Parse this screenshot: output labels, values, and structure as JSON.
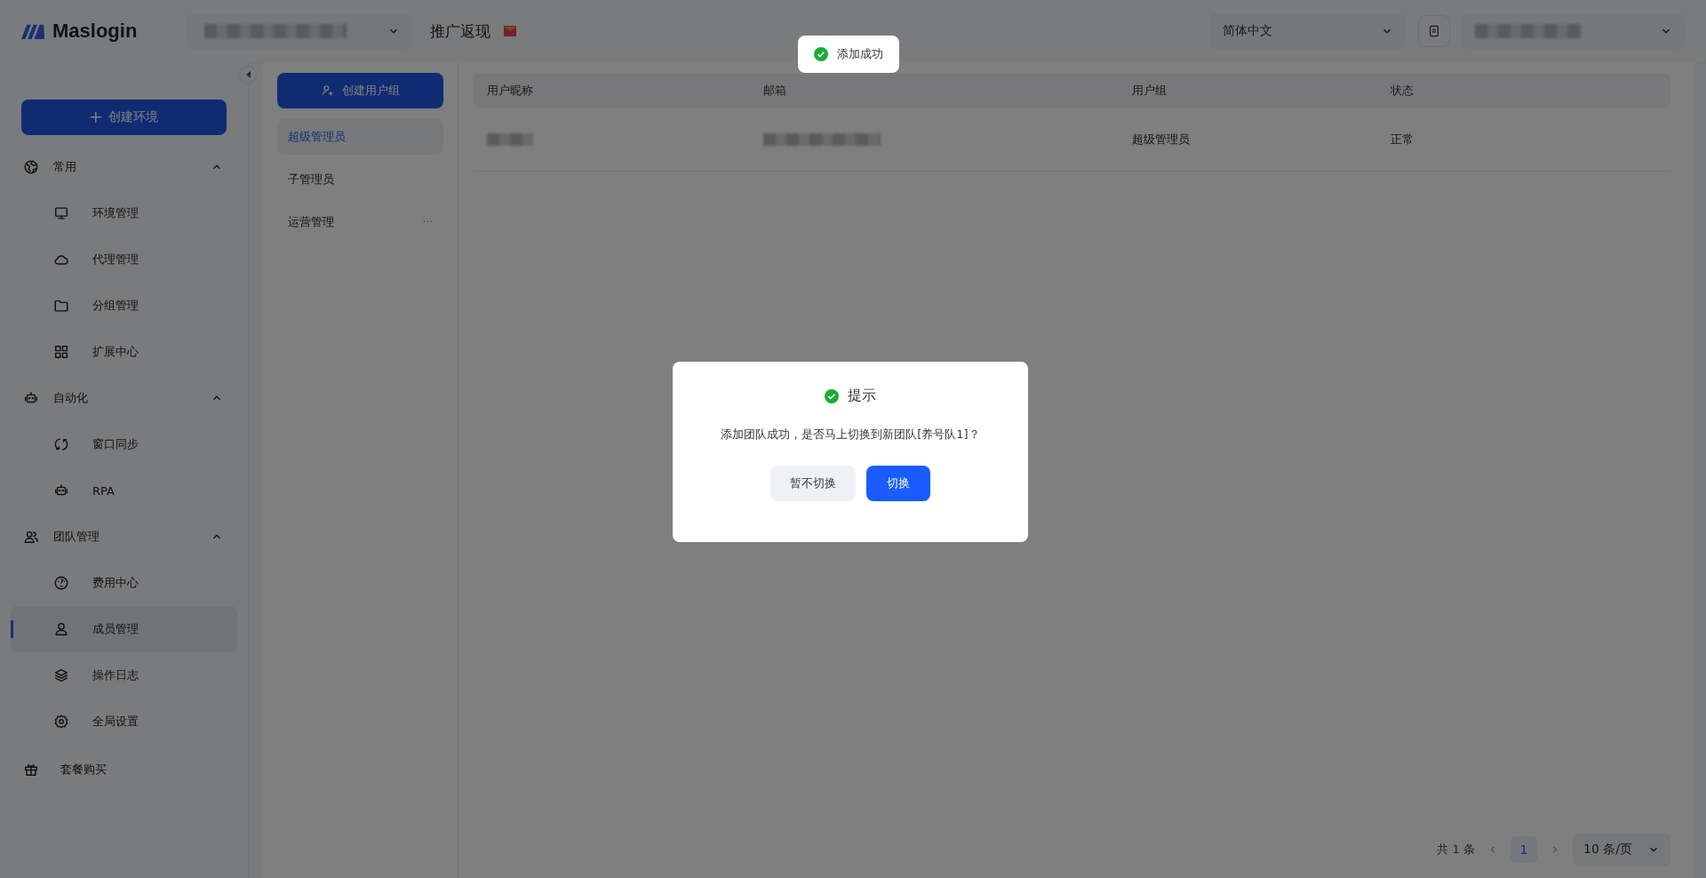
{
  "topbar": {
    "logo": "Maslogin",
    "promo": "推广返现",
    "language": "简体中文"
  },
  "toast": {
    "message": "添加成功"
  },
  "sidebar": {
    "create_button": "创建环境",
    "sections": [
      {
        "label": "常用",
        "expanded": true,
        "items": [
          {
            "label": "环境管理",
            "selected": false
          },
          {
            "label": "代理管理",
            "selected": false
          },
          {
            "label": "分组管理",
            "selected": false
          },
          {
            "label": "扩展中心",
            "selected": false
          }
        ]
      },
      {
        "label": "自动化",
        "expanded": true,
        "items": [
          {
            "label": "窗口同步",
            "selected": false
          },
          {
            "label": "RPA",
            "selected": false
          }
        ]
      },
      {
        "label": "团队管理",
        "expanded": true,
        "items": [
          {
            "label": "费用中心",
            "selected": false
          },
          {
            "label": "成员管理",
            "selected": true
          },
          {
            "label": "操作日志",
            "selected": false
          },
          {
            "label": "全局设置",
            "selected": false
          }
        ]
      }
    ],
    "footer_item": "套餐购买"
  },
  "groups": {
    "create_button": "创建用户组",
    "items": [
      {
        "label": "超级管理员",
        "selected": true
      },
      {
        "label": "子管理员",
        "selected": false
      },
      {
        "label": "运营管理",
        "selected": false,
        "menu": "···"
      }
    ]
  },
  "table": {
    "columns": [
      "用户昵称",
      "邮箱",
      "用户组",
      "状态"
    ],
    "rows": [
      {
        "group": "超级管理员",
        "status": "正常"
      }
    ]
  },
  "pagination": {
    "total": "共 1 条",
    "pages": [
      {
        "label": "1",
        "selected": true
      }
    ],
    "page_size": "10 条/页"
  },
  "dialog": {
    "title": "提示",
    "message": "添加团队成功，是否马上切换到新团队[养号队1]？",
    "buttons": [
      {
        "label": "暂不切换",
        "kind": "secondary"
      },
      {
        "label": "切换",
        "kind": "primary"
      }
    ]
  }
}
